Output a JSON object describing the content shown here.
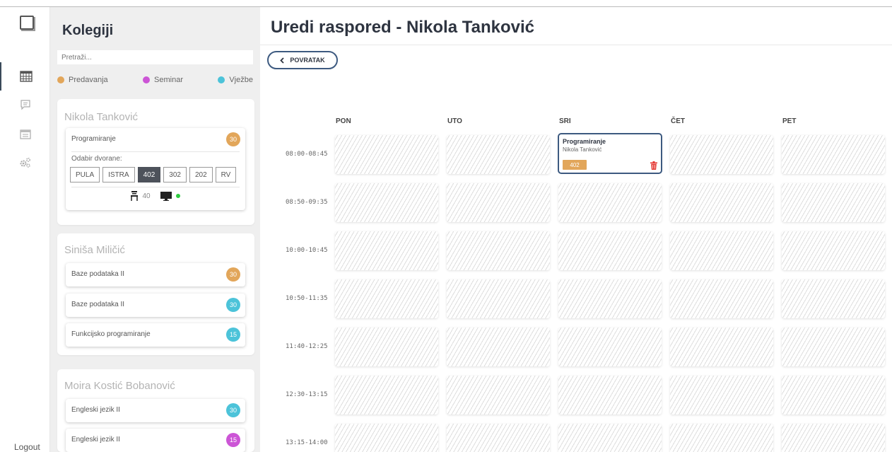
{
  "colors": {
    "lecture": "#e2a65a",
    "seminar": "#cc55d6",
    "exercise": "#4cc3d9",
    "primary": "#3d5a80"
  },
  "rail": {
    "items": [
      {
        "icon": "logo-icon"
      },
      {
        "icon": "calendar-grid-icon",
        "active": true
      },
      {
        "icon": "chat-icon"
      },
      {
        "icon": "schedule-icon"
      },
      {
        "icon": "gears-icon"
      }
    ],
    "logout_label": "Logout"
  },
  "panel": {
    "title": "Kolegiji",
    "search_placeholder": "Pretraži...",
    "legend": {
      "lecture": "Predavanja",
      "seminar": "Seminar",
      "exercise": "Vježbe"
    },
    "groups": [
      {
        "professor": "Nikola Tanković",
        "courses": [
          {
            "name": "Programiranje",
            "count": "30",
            "type": "lecture",
            "hall_label": "Odabir dvorane:",
            "halls": [
              "PULA",
              "ISTRA",
              "402",
              "302",
              "202",
              "RV"
            ],
            "selected_hall": "402",
            "seats": "40"
          }
        ]
      },
      {
        "professor": "Siniša Miličić",
        "courses": [
          {
            "name": "Baze podataka II",
            "count": "30",
            "type": "lecture"
          },
          {
            "name": "Baze podataka II",
            "count": "30",
            "type": "exercise"
          },
          {
            "name": "Funkcijsko programiranje",
            "count": "15",
            "type": "exercise"
          }
        ]
      },
      {
        "professor": "Moira Kostić Bobanović",
        "courses": [
          {
            "name": "Engleski jezik II",
            "count": "30",
            "type": "exercise"
          },
          {
            "name": "Engleski jezik II",
            "count": "15",
            "type": "seminar"
          }
        ]
      }
    ]
  },
  "main": {
    "title": "Uredi raspored - Nikola Tanković",
    "back_label": "POVRATAK",
    "days": [
      "PON",
      "UTO",
      "SRI",
      "ČET",
      "PET"
    ],
    "times": [
      "08:00-08:45",
      "08:50-09:35",
      "10:00-10:45",
      "10:50-11:35",
      "11:40-12:25",
      "12:30-13:15",
      "13:15-14:00"
    ],
    "events": [
      {
        "day": 2,
        "time": 0,
        "title": "Programiranje",
        "professor": "Nikola Tanković",
        "room": "402",
        "type": "lecture"
      }
    ]
  }
}
